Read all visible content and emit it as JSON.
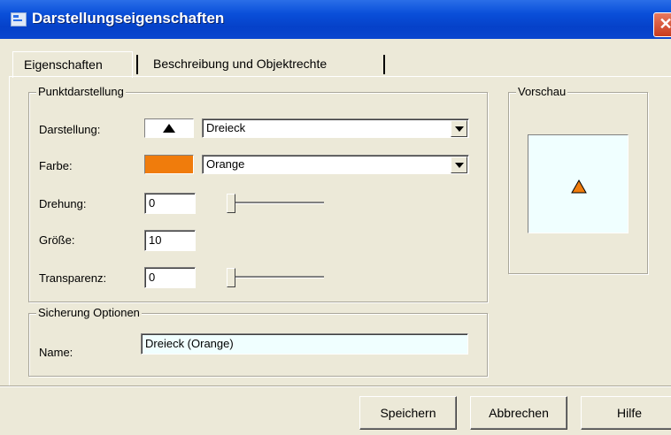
{
  "window": {
    "title": "Darstellungseigenschaften",
    "close_glyph": "✕"
  },
  "tabs": [
    {
      "label": "Eigenschaften",
      "active": true
    },
    {
      "label": "Beschreibung und Objektrechte",
      "active": false
    }
  ],
  "point_group": {
    "legend": "Punktdarstellung",
    "darstellung": {
      "label": "Darstellung:",
      "value": "Dreieck",
      "symbol": "triangle-icon"
    },
    "farbe": {
      "label": "Farbe:",
      "value": "Orange",
      "color": "#f07c0c"
    },
    "drehung": {
      "label": "Drehung:",
      "value": "0",
      "slider_value": 0
    },
    "groesse": {
      "label": "Größe:",
      "value": "10"
    },
    "transparenz": {
      "label": "Transparenz:",
      "value": "0",
      "slider_value": 0
    }
  },
  "preview": {
    "legend": "Vorschau",
    "background": "#f0ffff"
  },
  "save_group": {
    "legend": "Sicherung Optionen",
    "name_label": "Name:",
    "name_value": "Dreieck (Orange)"
  },
  "buttons": {
    "save": "Speichern",
    "cancel": "Abbrechen",
    "help": "Hilfe"
  }
}
